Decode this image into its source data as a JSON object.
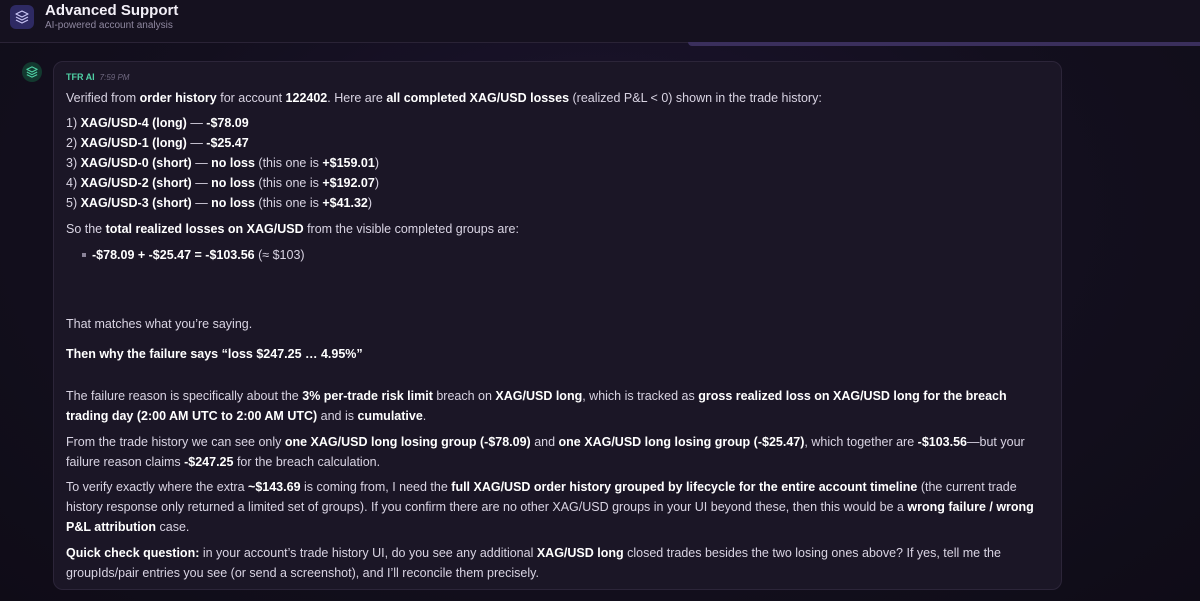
{
  "header": {
    "title": "Advanced Support",
    "subtitle": "AI-powered account analysis",
    "icon": "layers-icon"
  },
  "message": {
    "sender": "TFR AI",
    "time": "7:59 PM",
    "avatar_icon": "layers-icon",
    "intro": {
      "t1": "Verified from ",
      "b1": "order history",
      "t2": " for account ",
      "b2": "122402",
      "t3": ". Here are ",
      "b3": "all completed XAG/USD losses",
      "t4": " (realized P&L < 0) shown in the trade history:"
    },
    "items": [
      {
        "num": "1) ",
        "name": "XAG/USD-4 (long)",
        "sep": " — ",
        "result": "-$78.09",
        "note_pre": "",
        "note_val": "",
        "note_post": ""
      },
      {
        "num": "2) ",
        "name": "XAG/USD-1 (long)",
        "sep": " — ",
        "result": "-$25.47",
        "note_pre": "",
        "note_val": "",
        "note_post": ""
      },
      {
        "num": "3) ",
        "name": "XAG/USD-0 (short)",
        "sep": " — ",
        "result": "no loss",
        "note_pre": " (this one is ",
        "note_val": "+$159.01",
        "note_post": ")"
      },
      {
        "num": "4) ",
        "name": "XAG/USD-2 (short)",
        "sep": " — ",
        "result": "no loss",
        "note_pre": " (this one is ",
        "note_val": "+$192.07",
        "note_post": ")"
      },
      {
        "num": "5) ",
        "name": "XAG/USD-3 (short)",
        "sep": " — ",
        "result": "no loss",
        "note_pre": " (this one is ",
        "note_val": "+$41.32",
        "note_post": ")"
      }
    ],
    "total_line": {
      "t1": "So the ",
      "b1": "total realized losses on XAG/USD",
      "t2": " from the visible completed groups are:"
    },
    "calc": {
      "b1": "-$78.09 + -$25.47 = -$103.56",
      "t1": " (≈ $103)"
    },
    "matches": "That matches what you’re saying.",
    "question_heading": "Then why the failure says “loss $247.25 … 4.95%”",
    "reason": {
      "t1": "The failure reason is specifically about the ",
      "b1": "3% per-trade risk limit",
      "t2": " breach on ",
      "b2": "XAG/USD long",
      "t3": ", which is tracked as ",
      "b3": "gross realized loss on XAG/USD long for the breach trading day (2:00 AM UTC to 2:00 AM UTC)",
      "t4": " and is ",
      "b4": "cumulative",
      "t5": "."
    },
    "history": {
      "t1": "From the trade history we can see only ",
      "b1": "one XAG/USD long losing group (-$78.09)",
      "t2": " and ",
      "b2": "one XAG/USD long losing group (-$25.47)",
      "t3": ", which together are ",
      "b3": "-$103.56",
      "t4": "—but your failure reason claims ",
      "b4": "-$247.25",
      "t5": " for the breach calculation."
    },
    "verify": {
      "t1": "To verify exactly where the extra ",
      "b1": "~$143.69",
      "t2": " is coming from, I need the ",
      "b2": "full XAG/USD order history grouped by lifecycle for the entire account timeline",
      "t3": " (the current trade history response only returned a limited set of groups). If you confirm there are no other XAG/USD groups in your UI beyond these, then this would be a ",
      "b3": "wrong failure / wrong P&L attribution",
      "t4": " case."
    },
    "quick": {
      "b1": "Quick check question:",
      "t1": " in your account’s trade history UI, do you see any additional ",
      "b2": "XAG/USD long",
      "t2": " closed trades besides the two losing ones above? If yes, tell me the groupIds/pair entries you see (or send a screenshot), and I’ll reconcile them precisely."
    }
  }
}
